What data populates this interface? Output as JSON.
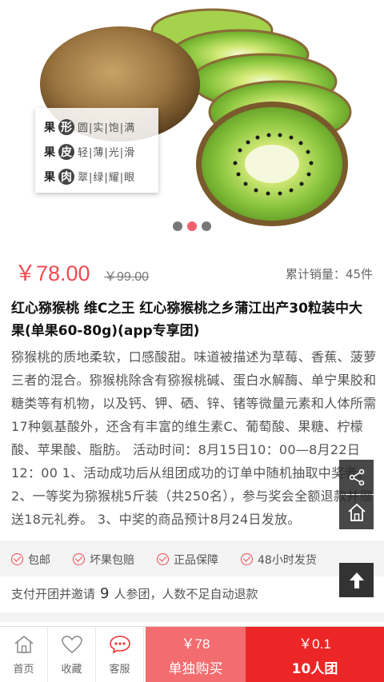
{
  "hero": {
    "features": [
      {
        "key": "果",
        "attr": "形",
        "desc": "圆|实|饱|满"
      },
      {
        "key": "果",
        "attr": "皮",
        "desc": "轻|薄|光|滑"
      },
      {
        "key": "果",
        "attr": "肉",
        "desc": "翠|绿|耀|眼"
      }
    ],
    "carousel_dots": 3,
    "active_dot": 1
  },
  "product": {
    "price": "￥78.00",
    "original_price": "￥99.00",
    "sales": "累计销量：45件",
    "title": "红心猕猴桃 维C之王 红心猕猴桃之乡蒲江出产30粒装中大果(单果60-80g)(app专享团)",
    "description": "猕猴桃的质地柔软，口感酸甜。味道被描述为草莓、香蕉、菠萝三者的混合。猕猴桃除含有猕猴桃碱、蛋白水解酶、单宁果胶和糖类等有机物，以及钙、钾、硒、锌、锗等微量元素和人体所需17种氨基酸外，还含有丰富的维生素C、葡萄酸、果糖、柠檬酸、苹果酸、脂肪。 活动时间：8月15日10：00—8月22日12：00  1、活动成功后从组团成功的订单中随机抽取中奖者。 2、一等奖为猕猴桃5斤装（共250名），参与奖会全额退款并赠送18元礼券。 3、中奖的商品预计8月24日发放。"
  },
  "guarantees": [
    "包邮",
    "坏果包赔",
    "正品保障",
    "48小时发货"
  ],
  "group_note": {
    "prefix": "支付开团并邀请",
    "count": "9",
    "suffix": "人参团，人数不足自动退款"
  },
  "bottom_nav": {
    "home": "首页",
    "favorite": "收藏",
    "service": "客服"
  },
  "buy": {
    "solo_price": "￥78",
    "solo_label": "单独购买",
    "group_price": "￥0.1",
    "group_label": "10人团"
  },
  "colors": {
    "accent": "#f04a50",
    "group_button": "#ec2626",
    "solo_button": "#f26c70",
    "kiwi_green": "#8cc63f"
  }
}
